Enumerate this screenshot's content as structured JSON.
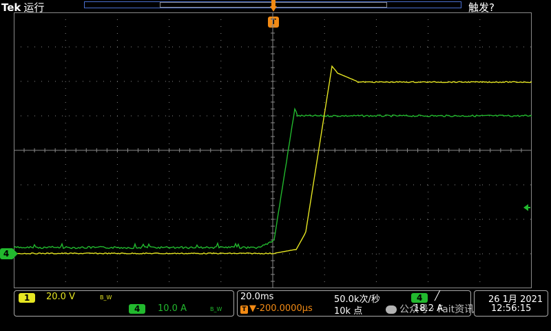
{
  "header": {
    "brand": "Tek",
    "run_state": "运行",
    "trigger_state": "触发?"
  },
  "markers": {
    "trigger_time_marker": "T",
    "ch4_ground": "4"
  },
  "colors": {
    "ch1": "#e6e622",
    "ch4": "#22b92e",
    "grid": "#8a8a8a",
    "trigger": "#f28a14",
    "record_bar": "#4a6fd0"
  },
  "icons": {
    "trigger_level": "left-arrow-icon"
  },
  "channels": {
    "ch1": {
      "label": "1",
      "scale": "20.0 V",
      "bw": "B_W"
    },
    "ch4": {
      "label": "4",
      "scale": "10.0 A",
      "bw": "B_W"
    }
  },
  "timebase": {
    "scale": "20.0ms",
    "trigger_offset": "▼-200.0000μs",
    "sample_rate": "50.0k次/秒",
    "record_length": "10k 点"
  },
  "trigger": {
    "source": "4",
    "slope": "╱",
    "level": "18.2 A"
  },
  "datetime": {
    "date": "26 1月 2021",
    "time": "12:56:15"
  },
  "overlay": {
    "watermark": "公众号 · Fait资讯"
  }
}
